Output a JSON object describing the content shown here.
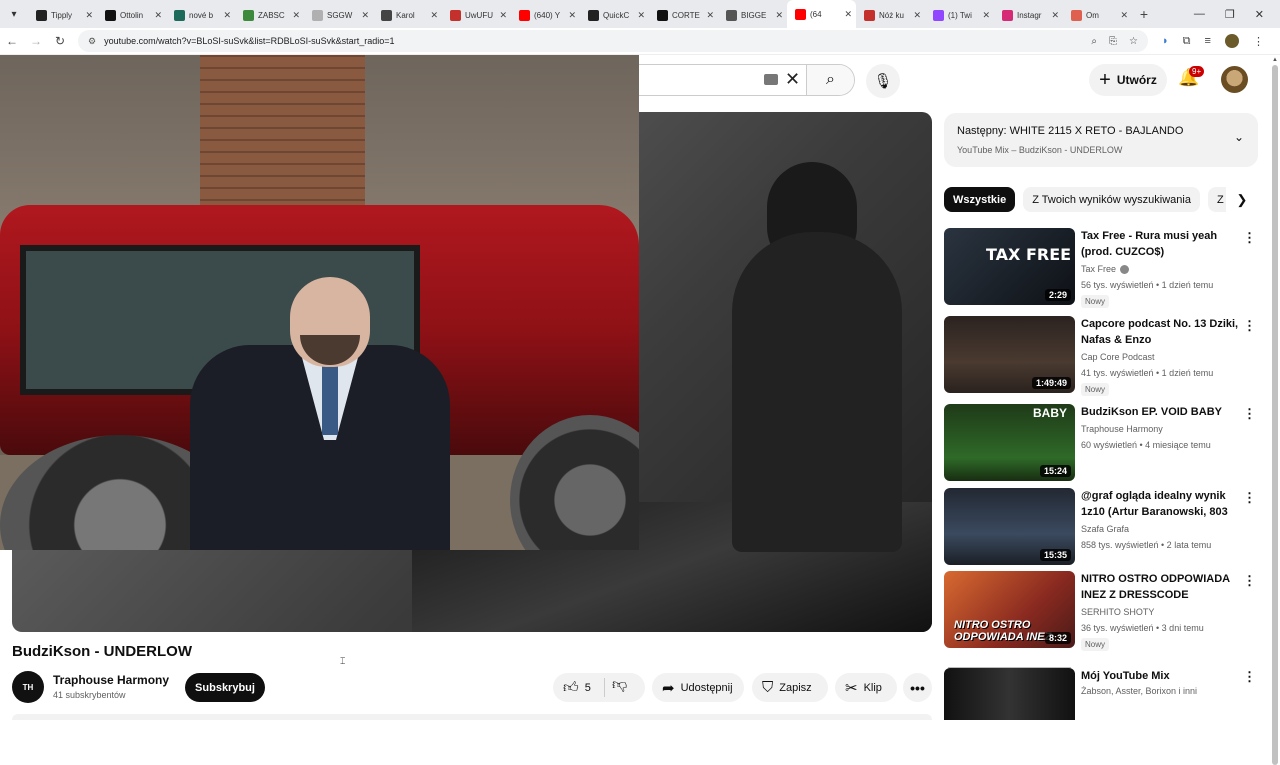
{
  "browser": {
    "tabs": [
      {
        "title": "Tipply",
        "color": "#222"
      },
      {
        "title": "Ottolin",
        "color": "#111"
      },
      {
        "title": "nové b",
        "color": "#1c6b5a"
      },
      {
        "title": "ZABSC",
        "color": "#3d8a3d"
      },
      {
        "title": "SGGW",
        "color": "#b0b0b0"
      },
      {
        "title": "Karol",
        "color": "#444"
      },
      {
        "title": "UwUFU",
        "color": "#c4302b"
      },
      {
        "title": "(640) Y",
        "color": "#ff0000"
      },
      {
        "title": "QuickC",
        "color": "#222"
      },
      {
        "title": "CORTE",
        "color": "#111"
      },
      {
        "title": "BIGGE",
        "color": "#555"
      },
      {
        "title": "(64",
        "color": "#ff0000",
        "active": true
      },
      {
        "title": "Nóż ku",
        "color": "#c4302b"
      },
      {
        "title": "(1) Twi",
        "color": "#9146ff"
      },
      {
        "title": "Instagr",
        "color": "#d62976"
      },
      {
        "title": "Om",
        "color": "#e06050"
      }
    ],
    "url": "youtube.com/watch?v=BLoSI-suSvk&list=RDBLoSI-suSvk&start_radio=1"
  },
  "header": {
    "create_label": "Utwórz",
    "notifications_badge": "9+"
  },
  "video": {
    "title": "BudziKson - UNDERLOW",
    "channel_initials": "TH",
    "channel_name": "Traphouse Harmony",
    "subscribers": "41 subskrybentów",
    "subscribe_label": "Subskrybuj",
    "like_count": "5",
    "share_label": "Udostępnij",
    "save_label": "Zapisz",
    "clip_label": "Klip"
  },
  "next_up": {
    "line1": "Następny: WHITE 2115 X RETO - BAJLANDO",
    "line2": "YouTube Mix – BudziKson - UNDERLOW"
  },
  "chips": [
    "Wszystkie",
    "Z Twoich wyników wyszukiwania",
    "Z"
  ],
  "recommendations": [
    {
      "title": "Tax Free - Rura musi yeah (prod. CUZCO$)",
      "channel": "Tax Free",
      "meta": "56 tys. wyświetleń • 1 dzień temu",
      "badge": "Nowy",
      "duration": "2:29",
      "thumb_text": "TAX FREE",
      "verified": true
    },
    {
      "title": "Capcore podcast No. 13 Dziki, Nafas & Enzo",
      "channel": "Cap Core Podcast",
      "meta": "41 tys. wyświetleń • 1 dzień temu",
      "badge": "Nowy",
      "duration": "1:49:49"
    },
    {
      "title": "BudziKson EP. VOID BABY",
      "channel": "Traphouse Harmony",
      "meta": "60 wyświetleń • 4 miesiące temu",
      "duration": "15:24",
      "thumb_text": "BABY"
    },
    {
      "title": "@graf ogląda idealny wynik 1z10 (Artur Baranowski, 803 …",
      "channel": "Szafa Grafa",
      "meta": "858 tys. wyświetleń • 2 lata temu",
      "duration": "15:35"
    },
    {
      "title": "NITRO OSTRO ODPOWIADA INEZ Z DRESSCODE",
      "channel": "SERHITO SHOTY",
      "meta": "36 tys. wyświetleń • 3 dni temu",
      "badge": "Nowy",
      "duration": "8:32",
      "thumb_text": "NITRO OSTRO ODPOWIADA INEZ"
    },
    {
      "title": "Mój YouTube Mix",
      "channel": "Żabson, Asster, Borixon i inni"
    }
  ]
}
